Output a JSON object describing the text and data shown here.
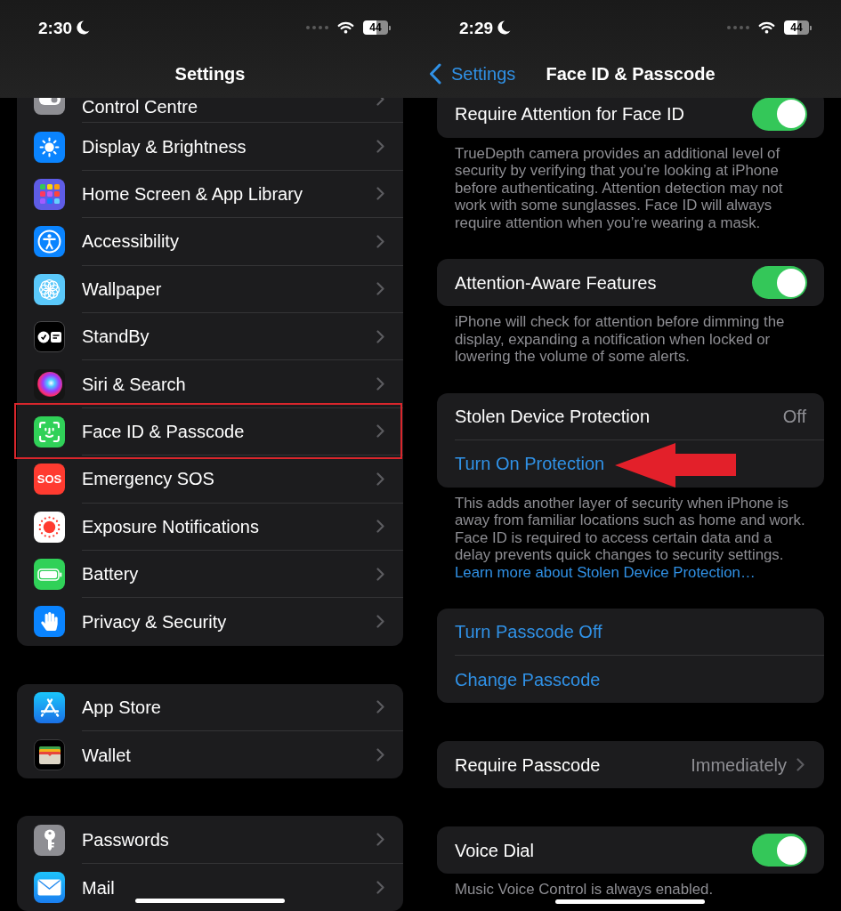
{
  "settings_screen": {
    "status_bar": {
      "time": "2:30",
      "battery": "44"
    },
    "title": "Settings",
    "groups": [
      {
        "items": [
          {
            "label": "Control Centre",
            "highlighted": false
          },
          {
            "label": "Display & Brightness",
            "highlighted": false
          },
          {
            "label": "Home Screen & App Library",
            "highlighted": false
          },
          {
            "label": "Accessibility",
            "highlighted": false
          },
          {
            "label": "Wallpaper",
            "highlighted": false
          },
          {
            "label": "StandBy",
            "highlighted": false
          },
          {
            "label": "Siri & Search",
            "highlighted": false
          },
          {
            "label": "Face ID & Passcode",
            "highlighted": true
          },
          {
            "label": "Emergency SOS",
            "icon_text": "SOS",
            "highlighted": false
          },
          {
            "label": "Exposure Notifications",
            "highlighted": false
          },
          {
            "label": "Battery",
            "highlighted": false
          },
          {
            "label": "Privacy & Security",
            "highlighted": false
          }
        ]
      },
      {
        "items": [
          {
            "label": "App Store",
            "highlighted": false
          },
          {
            "label": "Wallet",
            "highlighted": false
          }
        ]
      },
      {
        "items": [
          {
            "label": "Passwords",
            "highlighted": false
          },
          {
            "label": "Mail",
            "highlighted": false
          }
        ]
      }
    ]
  },
  "face_id_screen": {
    "status_bar": {
      "time": "2:29",
      "battery": "44"
    },
    "back_label": "Settings",
    "title": "Face ID & Passcode",
    "sections": [
      {
        "rows": [
          {
            "kind": "toggle",
            "label": "Require Attention for Face ID",
            "on": true
          }
        ],
        "footer": "TrueDepth camera provides an additional level of security by verifying that you’re looking at iPhone before authenticating. Attention detection may not work with some sunglasses. Face ID will always require attention when you’re wearing a mask."
      },
      {
        "rows": [
          {
            "kind": "toggle",
            "label": "Attention-Aware Features",
            "on": true
          }
        ],
        "footer": "iPhone will check for attention before dimming the display, expanding a notification when locked or lowering the volume of some alerts."
      },
      {
        "rows": [
          {
            "kind": "value",
            "label": "Stolen Device Protection",
            "value": "Off"
          },
          {
            "kind": "action",
            "label": "Turn On Protection",
            "pointed": true
          }
        ],
        "footer": "This adds another layer of security when iPhone is away from familiar locations such as home and work. Face ID is required to access certain data and a delay prevents quick changes to security settings.",
        "footer_link": "Learn more about Stolen Device Protection…"
      },
      {
        "rows": [
          {
            "kind": "action",
            "label": "Turn Passcode Off",
            "pointed": false
          },
          {
            "kind": "action",
            "label": "Change Passcode",
            "pointed": false
          }
        ]
      },
      {
        "rows": [
          {
            "kind": "disclosure",
            "label": "Require Passcode",
            "value": "Immediately"
          }
        ]
      },
      {
        "rows": [
          {
            "kind": "toggle",
            "label": "Voice Dial",
            "on": true
          }
        ],
        "footer": "Music Voice Control is always enabled."
      }
    ]
  }
}
